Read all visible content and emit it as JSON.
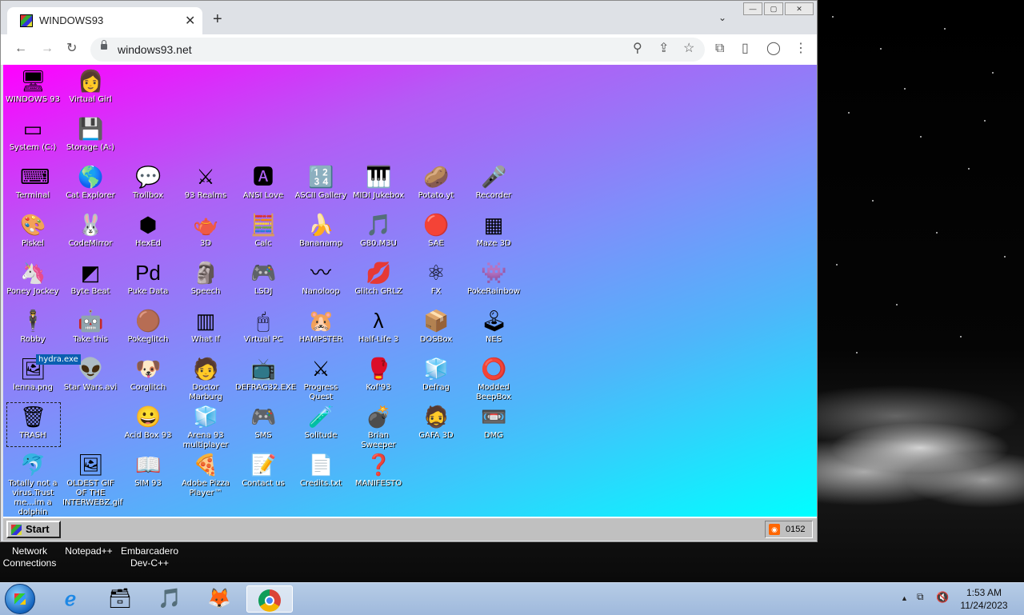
{
  "browser": {
    "tab_title": "WINDOWS93",
    "tab_close": "✕",
    "new_tab": "+",
    "tab_search": "⌄",
    "url": "windows93.net",
    "window_buttons": [
      "—",
      "▢",
      "✕"
    ],
    "toolbar_glyphs": {
      "back": "←",
      "forward": "→",
      "reload": "↻",
      "zoom": "⚲",
      "share": "⇪",
      "star": "☆",
      "extensions": "⧉",
      "sidepanel": "▯",
      "profile": "◯",
      "menu": "⋮"
    }
  },
  "desktop93": {
    "icons": [
      {
        "label": "WINDOWS 93",
        "glyph": "🖥",
        "col": 0,
        "row": 0
      },
      {
        "label": "Virtual Girl",
        "glyph": "👩",
        "col": 1,
        "row": 0
      },
      {
        "label": "System (C:)",
        "glyph": "▭",
        "col": 0,
        "row": 1
      },
      {
        "label": "Storage (A:)",
        "glyph": "💾",
        "col": 1,
        "row": 1
      },
      {
        "label": "Terminal",
        "glyph": "⌨",
        "col": 0,
        "row": 2
      },
      {
        "label": "Cat Explorer",
        "glyph": "🌎",
        "col": 1,
        "row": 2
      },
      {
        "label": "Trollbox",
        "glyph": "💬",
        "col": 2,
        "row": 2
      },
      {
        "label": "93 Realms",
        "glyph": "⚔",
        "col": 3,
        "row": 2
      },
      {
        "label": "ANSI Love",
        "glyph": "🅰",
        "col": 4,
        "row": 2
      },
      {
        "label": "ASCII Gallery",
        "glyph": "🔢",
        "col": 5,
        "row": 2
      },
      {
        "label": "MIDI Jukebox",
        "glyph": "🎹",
        "col": 6,
        "row": 2
      },
      {
        "label": "Potato.yt",
        "glyph": "🥔",
        "col": 7,
        "row": 2
      },
      {
        "label": "Recorder",
        "glyph": "🎤",
        "col": 8,
        "row": 2
      },
      {
        "label": "Piskel",
        "glyph": "🎨",
        "col": 0,
        "row": 3
      },
      {
        "label": "CodeMirror",
        "glyph": "🐰",
        "col": 1,
        "row": 3
      },
      {
        "label": "HexEd",
        "glyph": "⬢",
        "col": 2,
        "row": 3
      },
      {
        "label": "3D",
        "glyph": "🫖",
        "col": 3,
        "row": 3
      },
      {
        "label": "Calc",
        "glyph": "🧮",
        "col": 4,
        "row": 3
      },
      {
        "label": "Bananamp",
        "glyph": "🍌",
        "col": 5,
        "row": 3
      },
      {
        "label": "G80.M3U",
        "glyph": "🎵",
        "col": 6,
        "row": 3
      },
      {
        "label": "SAE",
        "glyph": "🔴",
        "col": 7,
        "row": 3
      },
      {
        "label": "Maze 3D",
        "glyph": "▦",
        "col": 8,
        "row": 3
      },
      {
        "label": "Poney Jockey",
        "glyph": "🦄",
        "col": 0,
        "row": 4
      },
      {
        "label": "Byte Beat",
        "glyph": "◩",
        "col": 1,
        "row": 4
      },
      {
        "label": "Puke Data",
        "glyph": "Pd",
        "col": 2,
        "row": 4
      },
      {
        "label": "Speech",
        "glyph": "🗿",
        "col": 3,
        "row": 4
      },
      {
        "label": "LSDJ",
        "glyph": "🎮",
        "col": 4,
        "row": 4
      },
      {
        "label": "Nanoloop",
        "glyph": "〰",
        "col": 5,
        "row": 4
      },
      {
        "label": "Glitch GRLZ",
        "glyph": "💋",
        "col": 6,
        "row": 4
      },
      {
        "label": "FX",
        "glyph": "⚛",
        "col": 7,
        "row": 4
      },
      {
        "label": "PokeRainbow",
        "glyph": "👾",
        "col": 8,
        "row": 4
      },
      {
        "label": "Robby",
        "glyph": "🕴",
        "col": 0,
        "row": 5
      },
      {
        "label": "Take this",
        "glyph": "🤖",
        "col": 1,
        "row": 5
      },
      {
        "label": "Pokeglitch",
        "glyph": "🟤",
        "col": 2,
        "row": 5
      },
      {
        "label": "What If",
        "glyph": "▥",
        "col": 3,
        "row": 5
      },
      {
        "label": "Virtual PC",
        "glyph": "🖱",
        "col": 4,
        "row": 5
      },
      {
        "label": "HAMPSTER",
        "glyph": "🐹",
        "col": 5,
        "row": 5
      },
      {
        "label": "Half-Life 3",
        "glyph": "λ",
        "col": 6,
        "row": 5
      },
      {
        "label": "DOSBox",
        "glyph": "📦",
        "col": 7,
        "row": 5
      },
      {
        "label": "NES",
        "glyph": "🕹",
        "col": 8,
        "row": 5
      },
      {
        "label": "lenna.png",
        "glyph": "🖼",
        "col": 0,
        "row": 6
      },
      {
        "label": "Star Wars.avi",
        "glyph": "👽",
        "col": 1,
        "row": 6
      },
      {
        "label": "Corglitch",
        "glyph": "🐶",
        "col": 2,
        "row": 6
      },
      {
        "label": "Doctor Marburg",
        "glyph": "🧑",
        "col": 3,
        "row": 6
      },
      {
        "label": "DEFRAG32.EXE",
        "glyph": "📺",
        "col": 4,
        "row": 6
      },
      {
        "label": "Progress Quest",
        "glyph": "⚔",
        "col": 5,
        "row": 6
      },
      {
        "label": "Kof'93",
        "glyph": "🥊",
        "col": 6,
        "row": 6
      },
      {
        "label": "Defrag",
        "glyph": "🧊",
        "col": 7,
        "row": 6
      },
      {
        "label": "Modded BeepBox",
        "glyph": "⭕",
        "col": 8,
        "row": 6
      },
      {
        "label": "TRASH",
        "glyph": "🗑",
        "col": 0,
        "row": 7
      },
      {
        "label": "Acid Box 93",
        "glyph": "😀",
        "col": 2,
        "row": 7
      },
      {
        "label": "Arena 93 multiplayer",
        "glyph": "🧊",
        "col": 3,
        "row": 7
      },
      {
        "label": "SMS",
        "glyph": "🎮",
        "col": 4,
        "row": 7
      },
      {
        "label": "Solitude",
        "glyph": "🧪",
        "col": 5,
        "row": 7
      },
      {
        "label": "Brian Sweeper",
        "glyph": "💣",
        "col": 6,
        "row": 7
      },
      {
        "label": "GAFA 3D",
        "glyph": "🧔",
        "col": 7,
        "row": 7
      },
      {
        "label": "DMG",
        "glyph": "📼",
        "col": 8,
        "row": 7
      },
      {
        "label": "Totally not a virus.Trust me...im a dolphin",
        "glyph": "🐬",
        "col": 0,
        "row": 8
      },
      {
        "label": "OLDEST GIF OF THE INTERWEBZ.gif",
        "glyph": "🖼",
        "col": 1,
        "row": 8
      },
      {
        "label": "SIM 93",
        "glyph": "📖",
        "col": 2,
        "row": 8
      },
      {
        "label": "Adobe Pizza Player™",
        "glyph": "🍕",
        "col": 3,
        "row": 8
      },
      {
        "label": "Contact us",
        "glyph": "📝",
        "col": 4,
        "row": 8
      },
      {
        "label": "Credits.txt",
        "glyph": "📄",
        "col": 5,
        "row": 8
      },
      {
        "label": "MANIFESTO",
        "glyph": "❓",
        "col": 6,
        "row": 8
      }
    ],
    "drag_label": "hydra.exe",
    "taskbar": {
      "start_label": "Start",
      "clock": "0152",
      "rss": "◉"
    }
  },
  "host_desktop_icons": [
    {
      "label": "Network Connections"
    },
    {
      "label": "Notepad++"
    },
    {
      "label": "Embarcadero Dev-C++"
    }
  ],
  "host_taskbar": {
    "apps": [
      {
        "name": "internet-explorer",
        "glyph": "ℯ"
      },
      {
        "name": "archive-manager",
        "glyph": "🗃"
      },
      {
        "name": "itunes",
        "glyph": "🎵"
      },
      {
        "name": "firefox",
        "glyph": "🦊"
      },
      {
        "name": "chrome",
        "glyph": ""
      }
    ],
    "tray": {
      "arrow": "▲",
      "network": "⧉",
      "volume": "🔇"
    },
    "time": "1:53 AM",
    "date": "11/24/2023"
  }
}
